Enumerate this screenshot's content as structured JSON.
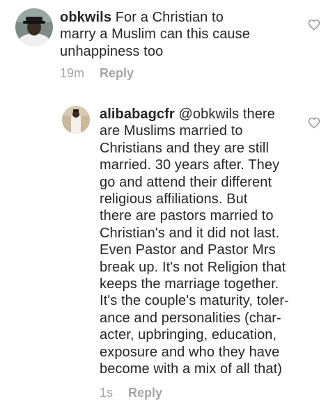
{
  "comments": [
    {
      "username": "obkwils",
      "lines": [
        "For a Christian to",
        "marry a Muslim can this cause",
        "unhappiness too"
      ],
      "time": "19m",
      "reply_label": "Reply",
      "like_icon": "heart-outline-icon"
    },
    {
      "username": "alibabagcfr",
      "lines": [
        "@obkwils there",
        "are Muslims married to",
        "Christians and they are still",
        "married. 30 years after. They",
        "go and attend their different",
        "religious affiliations. But",
        "there are pastors married to",
        "Christian's and it did not last.",
        "Even Pastor and Pastor Mrs",
        "break up. It's not Religion that",
        "keeps the marriage together.",
        "It's the couple's maturity, toler-",
        "ance and personalities (char-",
        "acter, upbringing, education,",
        "exposure and who they have",
        "become with a mix of all that)"
      ],
      "time": "1s",
      "reply_label": "Reply",
      "like_icon": "heart-outline-icon"
    }
  ],
  "colors": {
    "text": "#262626",
    "meta": "#a5a5a5",
    "icon": "#8e8e8e"
  }
}
